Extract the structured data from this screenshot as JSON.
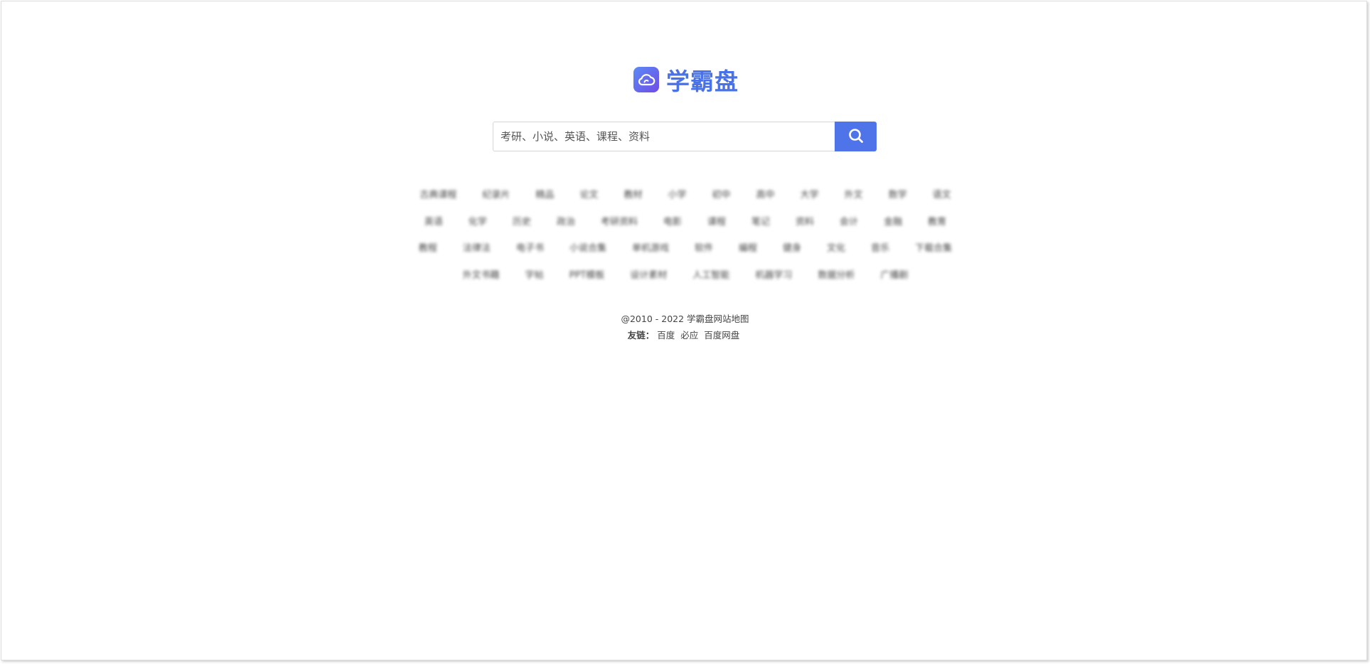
{
  "brand": {
    "name": "学霸盘",
    "icon": "cloud-icon",
    "icon_gradient": [
      "#5b8bf5",
      "#6f4ce6"
    ],
    "text_color": "#4a72e8"
  },
  "search": {
    "placeholder": "考研、小说、英语、课程、资料",
    "button_icon": "search-icon",
    "button_color": "#4f74ea"
  },
  "tags": [
    [
      "古典课程",
      "纪录片",
      "精品",
      "论文",
      "教材",
      "小学",
      "初中",
      "高中",
      "大学",
      "外文",
      "数学",
      "语文"
    ],
    [
      "英语",
      "化学",
      "历史",
      "政治",
      "考研资料",
      "电影",
      "课程",
      "笔记",
      "资料",
      "会计",
      "金融",
      "教育"
    ],
    [
      "教程",
      "法律法",
      "电子书",
      "小说合集",
      "单机游戏",
      "软件",
      "编程",
      "健身",
      "文化",
      "音乐",
      "下载合集"
    ],
    [
      "外文书籍",
      "字帖",
      "PPT模板",
      "设计素材",
      "人工智能",
      "机器学习",
      "数据分析",
      "广播剧"
    ]
  ],
  "footer": {
    "copyright": "@2010 - 2022 学霸盘网站地图",
    "links_label": "友链：",
    "links": [
      "百度",
      "必应",
      "百度网盘"
    ]
  }
}
